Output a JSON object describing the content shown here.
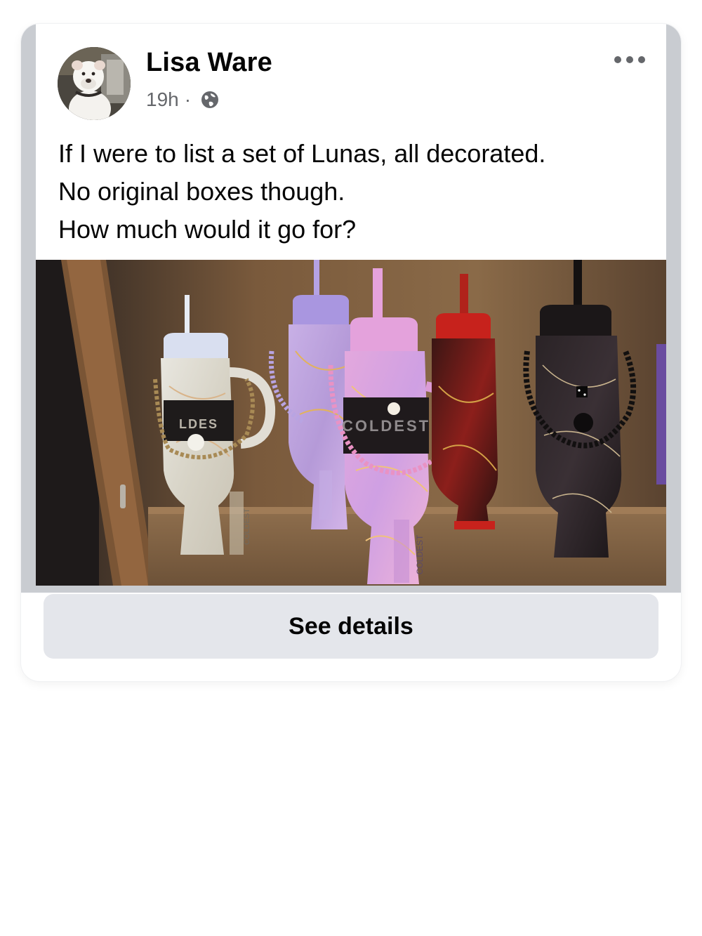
{
  "post": {
    "author": "Lisa Ware",
    "time": "19h",
    "separator": "·",
    "privacy_icon": "globe-icon",
    "more_icon": "more-options-icon",
    "text_lines": [
      "If I were to list a set of Lunas, all decorated.",
      "No original boxes though.",
      "How much would it go for?"
    ],
    "photo": {
      "tumbler_brand_marks": [
        "COLDEST",
        "COLDEST",
        "COLDEST"
      ]
    }
  },
  "actions": {
    "see_details_label": "See details"
  },
  "colors": {
    "card_frame": "#c9ccd1",
    "button_bg": "#e4e6eb",
    "meta_text": "#65676b",
    "primary_text": "#050505"
  }
}
